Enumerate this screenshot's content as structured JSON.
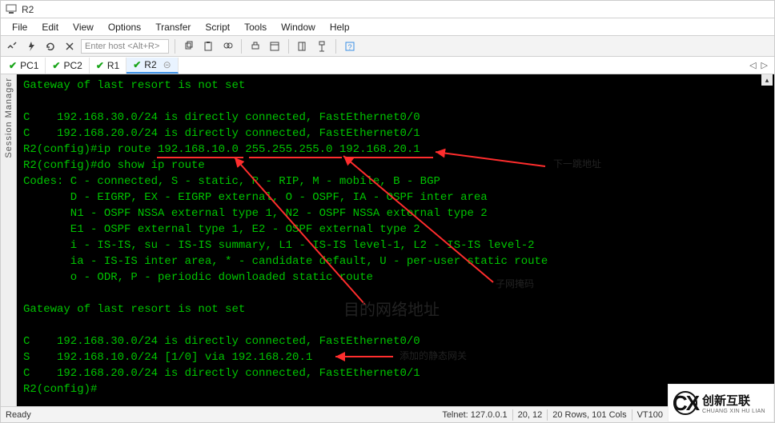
{
  "title": "R2",
  "menu": {
    "file": "File",
    "edit": "Edit",
    "view": "View",
    "options": "Options",
    "transfer": "Transfer",
    "script": "Script",
    "tools": "Tools",
    "window": "Window",
    "help": "Help"
  },
  "toolbar": {
    "host_placeholder": "Enter host <Alt+R>"
  },
  "tabs": [
    {
      "check": "✔",
      "label": "PC1"
    },
    {
      "check": "✔",
      "label": "PC2"
    },
    {
      "check": "✔",
      "label": "R1"
    },
    {
      "check": "✔",
      "label": "R2",
      "active": true
    }
  ],
  "sidebar_label": "Session Manager",
  "terminal_lines": [
    "Gateway of last resort is not set",
    "",
    "C    192.168.30.0/24 is directly connected, FastEthernet0/0",
    "C    192.168.20.0/24 is directly connected, FastEthernet0/1",
    "R2(config)#ip route 192.168.10.0 255.255.255.0 192.168.20.1",
    "R2(config)#do show ip route",
    "Codes: C - connected, S - static, R - RIP, M - mobile, B - BGP",
    "       D - EIGRP, EX - EIGRP external, O - OSPF, IA - OSPF inter area",
    "       N1 - OSPF NSSA external type 1, N2 - OSPF NSSA external type 2",
    "       E1 - OSPF external type 1, E2 - OSPF external type 2",
    "       i - IS-IS, su - IS-IS summary, L1 - IS-IS level-1, L2 - IS-IS level-2",
    "       ia - IS-IS inter area, * - candidate default, U - per-user static route",
    "       o - ODR, P - periodic downloaded static route",
    "",
    "Gateway of last resort is not set",
    "",
    "C    192.168.30.0/24 is directly connected, FastEthernet0/0",
    "S    192.168.10.0/24 [1/0] via 192.168.20.1",
    "C    192.168.20.0/24 is directly connected, FastEthernet0/1",
    "R2(config)#"
  ],
  "annotations": {
    "next_hop": "下一跳地址",
    "dest_net": "目的网络地址",
    "subnet": "子网掩码",
    "static_gateway": "添加的静态网关"
  },
  "status": {
    "ready": "Ready",
    "telnet": "Telnet: 127.0.0.1",
    "cursor": "20,  12",
    "size": "20 Rows, 101 Cols",
    "emu": "VT100"
  },
  "watermark": {
    "logo": "CX",
    "cn": "创新互联",
    "py": "CHUANG XIN HU LIAN"
  }
}
